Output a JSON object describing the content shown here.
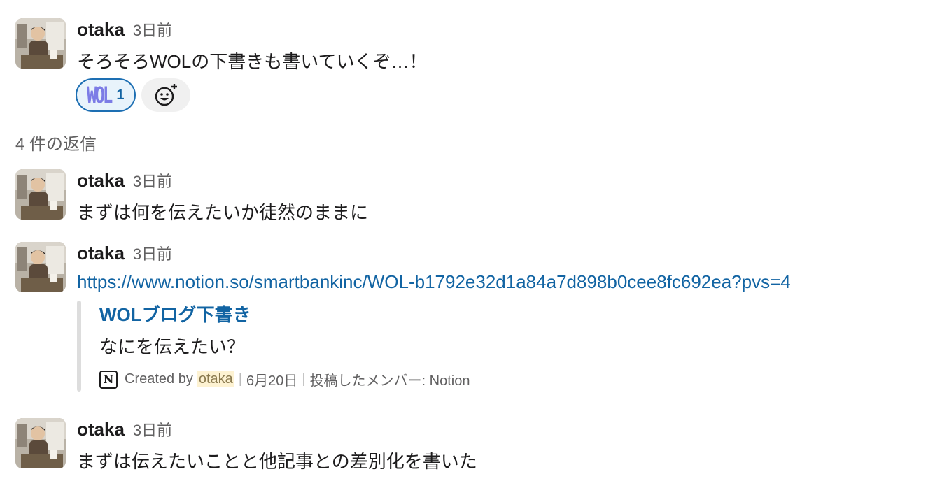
{
  "messages": [
    {
      "author": "otaka",
      "time": "3日前",
      "text": "そろそろWOLの下書きも書いていくぞ…！",
      "reactions": [
        {
          "emoji_label": "WOL",
          "count": "1"
        }
      ]
    },
    {
      "author": "otaka",
      "time": "3日前",
      "text": "まずは何を伝えたいか徒然のままに"
    },
    {
      "author": "otaka",
      "time": "3日前",
      "link": "https://www.notion.so/smartbankinc/WOL-b1792e32d1a84a7d898b0cee8fc692ea?pvs=4",
      "attachment": {
        "title": "WOLブログ下書き",
        "body": "なにを伝えたい？",
        "created_by_label": "Created by",
        "created_by_user": "otaka",
        "date": "6月20日",
        "posted_by": "投稿したメンバー: Notion",
        "icon": "notion-icon"
      }
    },
    {
      "author": "otaka",
      "time": "3日前",
      "text": "まずは伝えたいことと他記事との差別化を書いた"
    }
  ],
  "thread": {
    "replies_label": "4 件の返信"
  },
  "colors": {
    "link": "#1264a3",
    "reaction_border": "#1d6fb3",
    "reaction_bg": "#e8f3fb",
    "mention_bg": "#fdf2d2"
  }
}
